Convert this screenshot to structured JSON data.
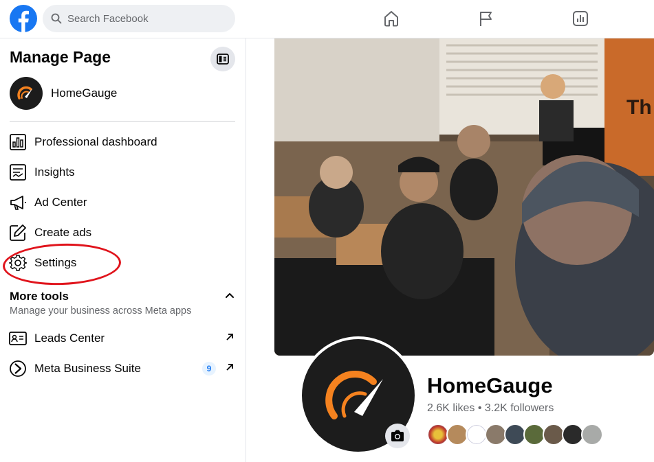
{
  "search": {
    "placeholder": "Search Facebook"
  },
  "sidebar": {
    "title": "Manage Page",
    "page_name": "HomeGauge",
    "menu": [
      {
        "label": "Professional dashboard",
        "icon": "dashboard-icon"
      },
      {
        "label": "Insights",
        "icon": "insights-icon"
      },
      {
        "label": "Ad Center",
        "icon": "megaphone-icon"
      },
      {
        "label": "Create ads",
        "icon": "edit-icon"
      },
      {
        "label": "Settings",
        "icon": "gear-icon"
      }
    ],
    "more_tools": {
      "title": "More tools",
      "subtitle": "Manage your business across Meta apps",
      "items": [
        {
          "label": "Leads Center",
          "icon": "contact-card-icon"
        },
        {
          "label": "Meta Business Suite",
          "icon": "business-suite-icon",
          "badge": "9"
        }
      ]
    }
  },
  "profile": {
    "name": "HomeGauge",
    "stats": "2.6K likes • 3.2K followers"
  },
  "colors": {
    "brand_blue": "#1877f2",
    "highlight_red": "#e0141c",
    "gauge_orange": "#f5821f"
  }
}
